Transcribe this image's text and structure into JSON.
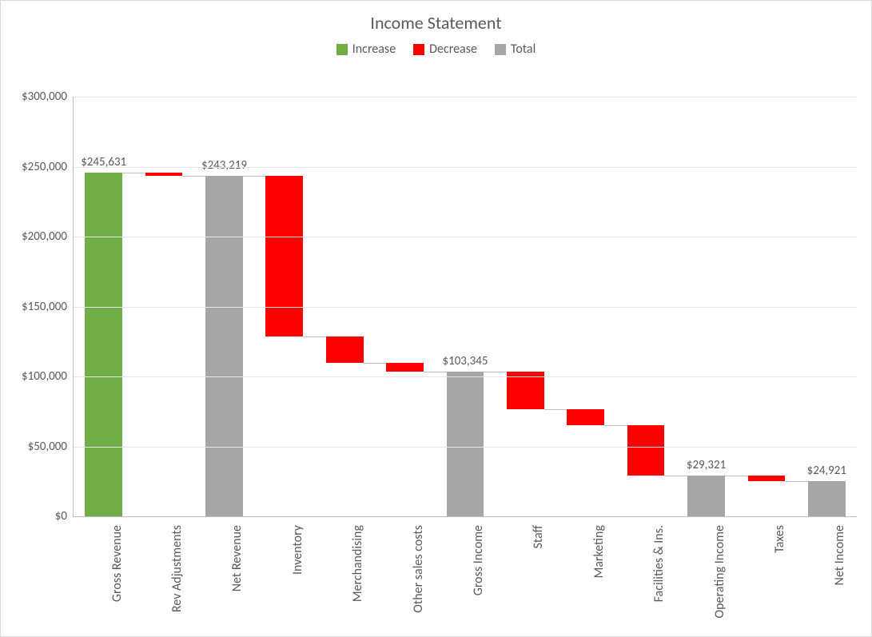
{
  "title": "Income Statement",
  "legend": {
    "increase": "Increase",
    "decrease": "Decrease",
    "total": "Total"
  },
  "chart_data": {
    "type": "bar",
    "subtype": "waterfall",
    "title": "Income Statement",
    "ylabel": "",
    "xlabel": "",
    "ylim": [
      0,
      300000
    ],
    "ytick_interval": 50000,
    "currency_prefix": "$",
    "legend": [
      "Increase",
      "Decrease",
      "Total"
    ],
    "categories": [
      "Gross Revenue",
      "Rev Adjustments",
      "Net Revenue",
      "Inventory",
      "Merchandising",
      "Other sales costs",
      "Gross Income",
      "Staff",
      "Marketing",
      "Facilities & Ins.",
      "Operating Income",
      "Taxes",
      "Net Income"
    ],
    "items": [
      {
        "label": "Gross Revenue",
        "type": "increase",
        "value": 245631,
        "cumulative": 245631,
        "data_label": "$245,631"
      },
      {
        "label": "Rev Adjustments",
        "type": "decrease",
        "value": -2412,
        "cumulative": 243219,
        "data_label": ""
      },
      {
        "label": "Net Revenue",
        "type": "total",
        "value": 243219,
        "cumulative": 243219,
        "data_label": "$243,219"
      },
      {
        "label": "Inventory",
        "type": "decrease",
        "value": -114899,
        "cumulative": 128320,
        "data_label": ""
      },
      {
        "label": "Merchandising",
        "type": "decrease",
        "value": -18475,
        "cumulative": 109845,
        "data_label": ""
      },
      {
        "label": "Other sales costs",
        "type": "decrease",
        "value": -6500,
        "cumulative": 103345,
        "data_label": ""
      },
      {
        "label": "Gross Income",
        "type": "total",
        "value": 103345,
        "cumulative": 103345,
        "data_label": "$103,345"
      },
      {
        "label": "Staff",
        "type": "decrease",
        "value": -26745,
        "cumulative": 76600,
        "data_label": ""
      },
      {
        "label": "Marketing",
        "type": "decrease",
        "value": -11279,
        "cumulative": 65321,
        "data_label": ""
      },
      {
        "label": "Facilities & Ins.",
        "type": "decrease",
        "value": -36000,
        "cumulative": 29321,
        "data_label": ""
      },
      {
        "label": "Operating Income",
        "type": "total",
        "value": 29321,
        "cumulative": 29321,
        "data_label": "$29,321"
      },
      {
        "label": "Taxes",
        "type": "decrease",
        "value": -4400,
        "cumulative": 24921,
        "data_label": ""
      },
      {
        "label": "Net Income",
        "type": "total",
        "value": 24921,
        "cumulative": 24921,
        "data_label": "$24,921"
      }
    ]
  }
}
